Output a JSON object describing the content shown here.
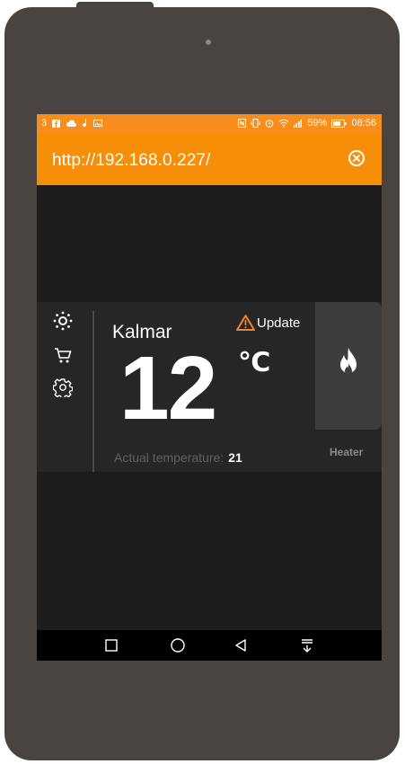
{
  "status_bar": {
    "left": "3",
    "battery_percent": "59%",
    "time": "08:56"
  },
  "browser": {
    "url": "http://192.168.0.227/"
  },
  "device": {
    "city": "Kalmar",
    "update_label": "Update",
    "set_temperature": "12",
    "unit": "℃",
    "actual_label": "Actual temperature:",
    "actual_value": "21",
    "heater_label": "Heater"
  },
  "colors": {
    "accent": "#f78e08",
    "warning": "#f0832a",
    "card_bg": "#262626",
    "screen_bg": "#1c1c1c"
  },
  "icons": {
    "sidebar": [
      "brightness-icon",
      "cart-icon",
      "settings-gear-icon"
    ],
    "heater": "flame-icon",
    "update": "warning-triangle-icon",
    "nav": [
      "square-recents-icon",
      "circle-home-icon",
      "triangle-back-icon",
      "download-arrow-icon"
    ]
  }
}
